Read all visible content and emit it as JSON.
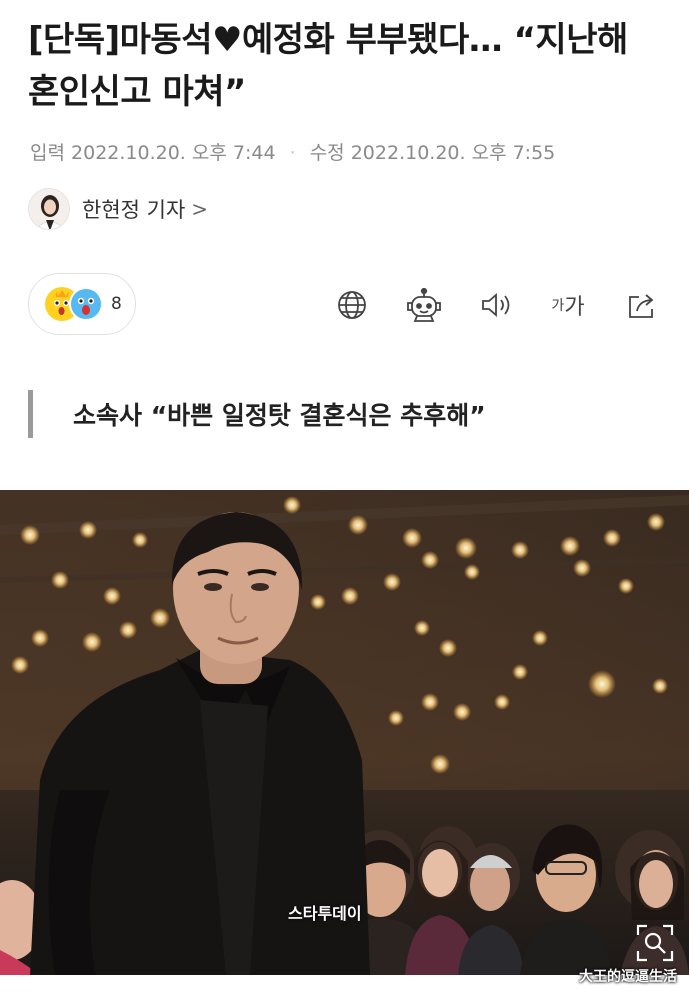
{
  "article": {
    "headline": "[단독]마동석♥예정화 부부됐다… “지난해 혼인신고 마쳐”",
    "published_label": "입력",
    "published": "2022.10.20. 오후 7:44",
    "modified_label": "수정",
    "modified": "2022.10.20. 오후 7:55",
    "reporter": "한현정 기자",
    "reporter_chevron": ">",
    "subhead": "소속사 “바쁜 일정탓 결혼식은 추후해”"
  },
  "reactions": {
    "count": "8",
    "emojis": [
      "surprised-face-icon",
      "shocked-face-icon"
    ]
  },
  "toolbar": {
    "icons": [
      "globe-icon",
      "robot-icon",
      "speaker-icon",
      "font-size-icon",
      "share-icon"
    ],
    "font_size_label_small": "가",
    "font_size_label_large": "가"
  },
  "photo": {
    "watermark": "스타투데이",
    "zoom_icon": "zoom-icon"
  },
  "overlay": {
    "watermark": "大王的逗逼生活"
  },
  "colors": {
    "text": "#1a1a1a",
    "meta": "#8a8a8a",
    "border": "#e2e2e2",
    "quote_bar": "#9a9a9a",
    "photo_dark": "#1c1816",
    "bokeh": "#ffe9b0"
  }
}
